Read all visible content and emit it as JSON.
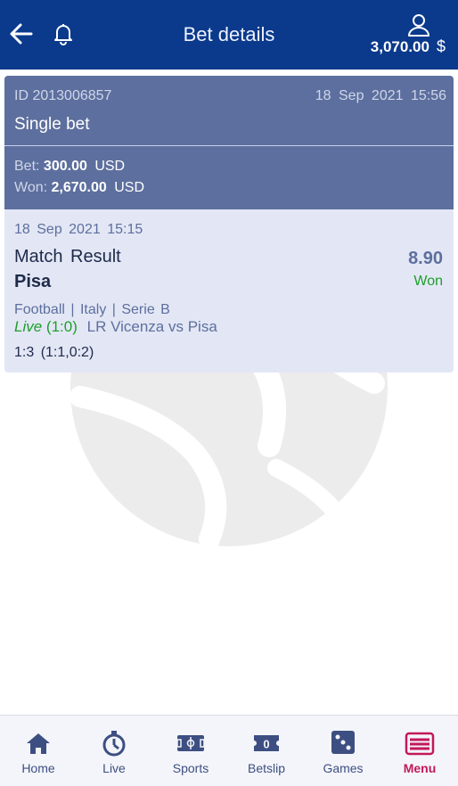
{
  "header": {
    "title": "Bet details",
    "balance": "3,070.00",
    "currency": "$",
    "back_icon": "arrow-left-icon",
    "bell_icon": "bell-icon",
    "user_icon": "user-icon"
  },
  "bet": {
    "id": "ID 2013006857",
    "datetime": "18 Sep 2021 15:56",
    "type": "Single bet",
    "bet_label": "Bet:",
    "bet_amount": "300.00",
    "won_label": "Won:",
    "won_amount": "2,670.00",
    "currency": "USD"
  },
  "event": {
    "datetime": "18 Sep 2021 15:15",
    "market": "Match Result",
    "selection": "Pisa",
    "odds": "8.90",
    "status": "Won",
    "path": "Football | Italy | Serie B",
    "live_label": "Live",
    "live_score": "(1:0)",
    "match": "LR Vicenza vs Pisa",
    "score": "1:3 (1:1,0:2)"
  },
  "nav": {
    "items": [
      {
        "label": "Home",
        "icon": "home-icon"
      },
      {
        "label": "Live",
        "icon": "stopwatch-icon"
      },
      {
        "label": "Sports",
        "icon": "field-icon"
      },
      {
        "label": "Betslip",
        "icon": "ticket-icon",
        "count": "0"
      },
      {
        "label": "Games",
        "icon": "dice-icon"
      },
      {
        "label": "Menu",
        "icon": "menu-icon",
        "active": true
      }
    ]
  },
  "colors": {
    "header_bg": "#0b3a8c",
    "card_dark": "#5d6f9e",
    "card_light": "#e3e7f5",
    "won_green": "#1e9e2c",
    "active_nav": "#c2185b"
  }
}
